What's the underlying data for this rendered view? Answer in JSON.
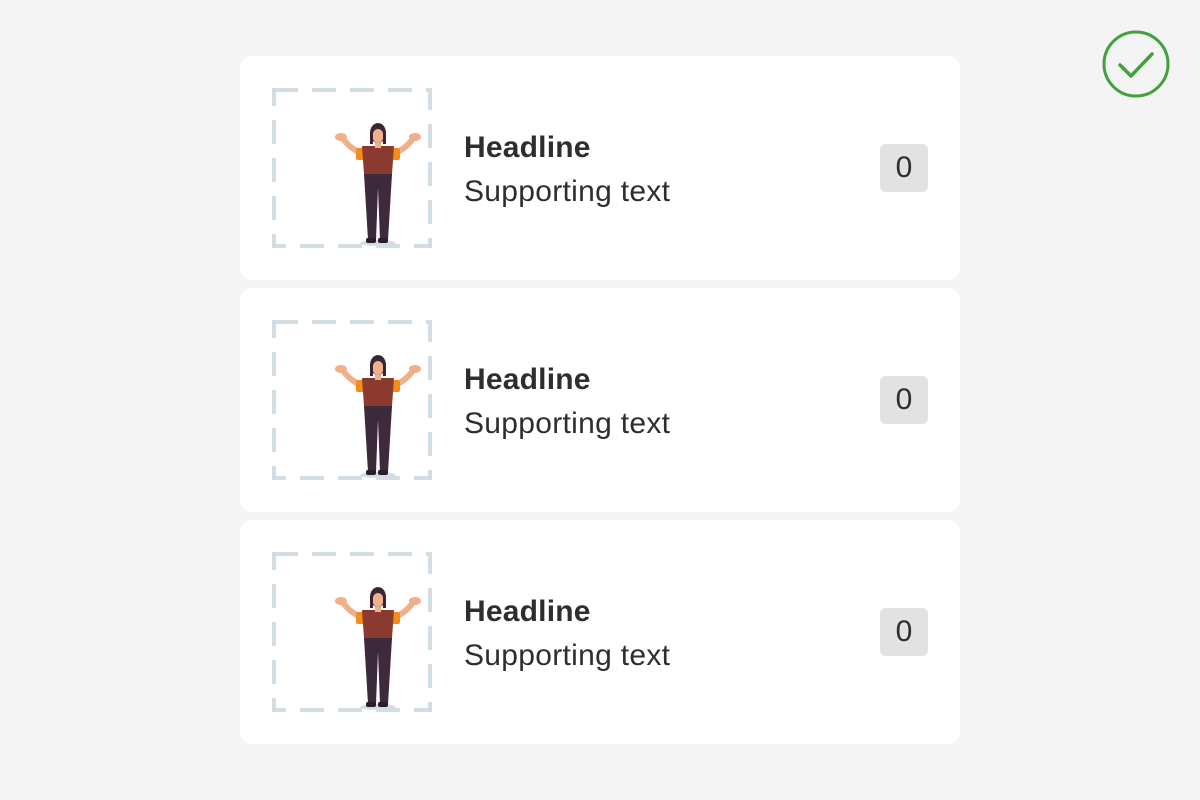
{
  "status": {
    "icon": "check-circle-icon",
    "color": "#3fa33a"
  },
  "list": {
    "items": [
      {
        "headline": "Headline",
        "supporting_text": "Supporting text",
        "count": "0",
        "image": "person-shrug-illustration"
      },
      {
        "headline": "Headline",
        "supporting_text": "Supporting text",
        "count": "0",
        "image": "person-shrug-illustration"
      },
      {
        "headline": "Headline",
        "supporting_text": "Supporting text",
        "count": "0",
        "image": "person-shrug-illustration"
      }
    ]
  },
  "colors": {
    "background": "#f4f4f4",
    "card": "#ffffff",
    "placeholder_dash": "#d3dde4",
    "badge_bg": "#e2e2e2",
    "text": "#2e2e2e"
  }
}
